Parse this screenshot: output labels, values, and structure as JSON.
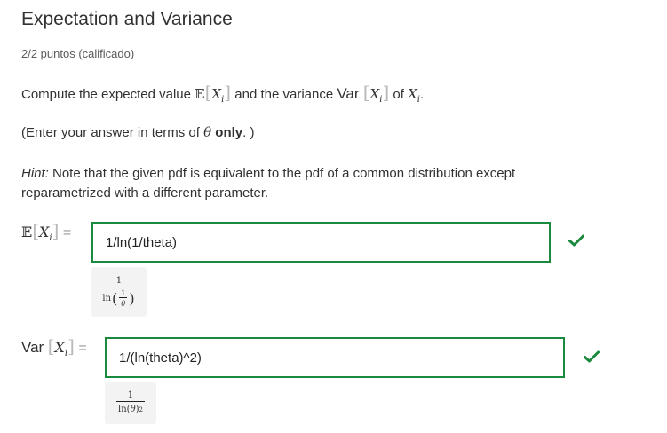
{
  "header": {
    "title": "Expectation and Variance",
    "score": "2/2 puntos (calificado)"
  },
  "question": {
    "prefix": "Compute the expected value",
    "mid": "and the variance",
    "of": "of",
    "var_word": "Var",
    "E_symbol": "𝔼",
    "X": "X",
    "i": "i",
    "end": "."
  },
  "note": {
    "before": "(Enter your answer in terms of",
    "theta": "θ",
    "bold": "only",
    "after": ". )"
  },
  "hint": {
    "label": "Hint:",
    "text": " Note that the given pdf is equivalent to the pdf of a common distribution except reparametrized with a different parameter."
  },
  "answers": [
    {
      "label_var": "",
      "input_value": "1/ln(1/theta)",
      "status": "correct",
      "preview": {
        "numerator": "1",
        "den_fn": "ln",
        "inner_num": "1",
        "inner_den": "θ"
      }
    },
    {
      "label_var": "Var",
      "input_value": "1/(ln(theta)^2)",
      "status": "correct",
      "preview": {
        "numerator": "1",
        "den_fn": "ln",
        "den_arg": "θ",
        "power": "2"
      }
    }
  ],
  "colors": {
    "correct": "#1c8a3e",
    "text": "#313131"
  },
  "icons": {
    "correct": "checkmark-icon"
  }
}
